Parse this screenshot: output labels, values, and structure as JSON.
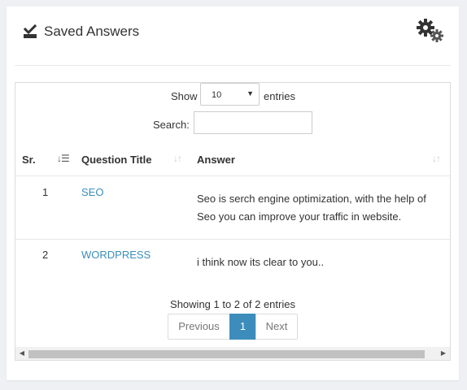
{
  "panel": {
    "title": "Saved Answers",
    "title_icon": "check-tray-icon",
    "settings_icon": "gears-icon"
  },
  "table": {
    "length_label": "Show",
    "length_value": "10",
    "length_suffix": "entries",
    "search_label": "Search:",
    "search_value": "",
    "columns": [
      "Sr.",
      "Question Title",
      "Answer"
    ],
    "rows": [
      {
        "sr": "1",
        "title": "SEO",
        "answer_line1": "Seo is serch engine optimization, with the help of",
        "answer_line2": "Seo you can improve your traffic in website."
      },
      {
        "sr": "2",
        "title": "WORDPRESS",
        "answer_line1": "i think now its clear to you.."
      }
    ],
    "info": "Showing 1 to 2 of 2 entries",
    "pagination": {
      "previous": "Previous",
      "current": "1",
      "next": "Next"
    }
  },
  "colors": {
    "accent": "#3c8dbc",
    "link": "#3c8dbc",
    "page_bg": "#eef0f3"
  }
}
